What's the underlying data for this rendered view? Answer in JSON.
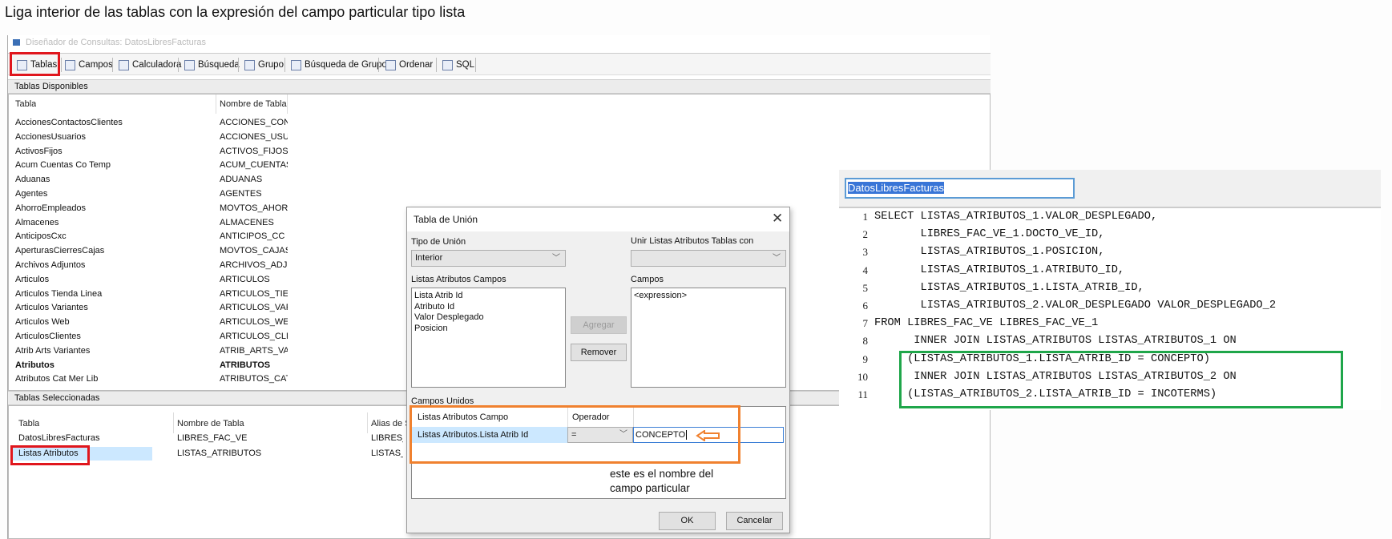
{
  "heading": "Liga interior de las tablas con la expresión del campo particular tipo lista",
  "window": {
    "title": "Diseñador de Consultas: DatosLibresFacturas",
    "toolbar": [
      {
        "label": "Tablas",
        "icon": "table-icon"
      },
      {
        "label": "Campos",
        "icon": "fields-icon"
      },
      {
        "label": "Calculadora",
        "icon": "calculator-icon"
      },
      {
        "label": "Búsqueda",
        "icon": "search-icon"
      },
      {
        "label": "Grupo",
        "icon": "filter-icon"
      },
      {
        "label": "Búsqueda de Grupo",
        "icon": "group-search-icon"
      },
      {
        "label": "Ordenar",
        "icon": "sort-icon"
      },
      {
        "label": "SQL",
        "icon": "sql-icon"
      }
    ],
    "available": {
      "title": "Tablas Disponibles",
      "columns": [
        "Tabla",
        "Nombre de Tabla"
      ],
      "rows": [
        [
          "AccionesContactosClientes",
          "ACCIONES_CONTAC"
        ],
        [
          "AccionesUsuarios",
          "ACCIONES_USUARI"
        ],
        [
          "ActivosFijos",
          "ACTIVOS_FIJOS"
        ],
        [
          "Acum Cuentas Co Temp",
          "ACUM_CUENTAS_C("
        ],
        [
          "Aduanas",
          "ADUANAS"
        ],
        [
          "Agentes",
          "AGENTES"
        ],
        [
          "AhorroEmpleados",
          "MOVTOS_AHORRO_"
        ],
        [
          "Almacenes",
          "ALMACENES"
        ],
        [
          "AnticiposCxc",
          "ANTICIPOS_CC"
        ],
        [
          "AperturasCierresCajas",
          "MOVTOS_CAJAS"
        ],
        [
          "Archivos Adjuntos",
          "ARCHIVOS_ADJUNT"
        ],
        [
          "Articulos",
          "ARTICULOS"
        ],
        [
          "Articulos Tienda Linea",
          "ARTICULOS_TIEND/"
        ],
        [
          "Articulos Variantes",
          "ARTICULOS_VARIAI"
        ],
        [
          "Articulos Web",
          "ARTICULOS_WEB"
        ],
        [
          "ArticulosClientes",
          "ARTICULOS_CLIENT"
        ],
        [
          "Atrib Arts Variantes",
          "ATRIB_ARTS_VARI/"
        ],
        [
          "Atributos",
          "ATRIBUTOS"
        ],
        [
          "Atributos Cat Mer Lib",
          "ATRIBUTOS_CAT_M"
        ]
      ],
      "bold_row": 17
    },
    "selected": {
      "title": "Tablas Seleccionadas",
      "columns": [
        "Tabla",
        "Nombre de Tabla",
        "Alias de S"
      ],
      "rows": [
        [
          "DatosLibresFacturas",
          "LIBRES_FAC_VE",
          "LIBRES_F"
        ],
        [
          "Listas Atributos",
          "LISTAS_ATRIBUTOS",
          "LISTAS_A"
        ]
      ]
    }
  },
  "dialog": {
    "title": "Tabla de Unión",
    "join_type_label": "Tipo de Unión",
    "join_type_value": "Interior",
    "join_with_label": "Unir Listas Atributos Tablas con",
    "join_with_value": "",
    "left_fields_label": "Listas Atributos Campos",
    "left_fields": [
      "Lista Atrib Id",
      "Atributo Id",
      "Valor Desplegado",
      "Posicion"
    ],
    "right_fields_label": "Campos",
    "right_fields": [
      "<expression>"
    ],
    "add_label": "Agregar",
    "remove_label": "Remover",
    "joined_label": "Campos Unidos",
    "joined_columns": [
      "Listas Atributos Campo",
      "Operador",
      ""
    ],
    "joined_row": {
      "field": "Listas Atributos.Lista Atrib Id",
      "operator": "=",
      "value": "CONCEPTO"
    },
    "annotation": [
      "este es el nombre del",
      "campo particular"
    ],
    "ok_label": "OK",
    "cancel_label": "Cancelar"
  },
  "sql": {
    "name": "DatosLibresFacturas",
    "lines": [
      "SELECT LISTAS_ATRIBUTOS_1.VALOR_DESPLEGADO,",
      "       LIBRES_FAC_VE_1.DOCTO_VE_ID,",
      "       LISTAS_ATRIBUTOS_1.POSICION,",
      "       LISTAS_ATRIBUTOS_1.ATRIBUTO_ID,",
      "       LISTAS_ATRIBUTOS_1.LISTA_ATRIB_ID,",
      "       LISTAS_ATRIBUTOS_2.VALOR_DESPLEGADO VALOR_DESPLEGADO_2",
      "FROM LIBRES_FAC_VE LIBRES_FAC_VE_1",
      "      INNER JOIN LISTAS_ATRIBUTOS LISTAS_ATRIBUTOS_1 ON",
      "     (LISTAS_ATRIBUTOS_1.LISTA_ATRIB_ID = CONCEPTO)",
      "      INNER JOIN LISTAS_ATRIBUTOS LISTAS_ATRIBUTOS_2 ON",
      "     (LISTAS_ATRIBUTOS_2.LISTA_ATRIB_ID = INCOTERMS)"
    ]
  },
  "colors": {
    "red_highlight": "#e0161d",
    "orange_highlight": "#f0812f",
    "green_highlight": "#1fa64a",
    "selection": "#cce8ff"
  }
}
